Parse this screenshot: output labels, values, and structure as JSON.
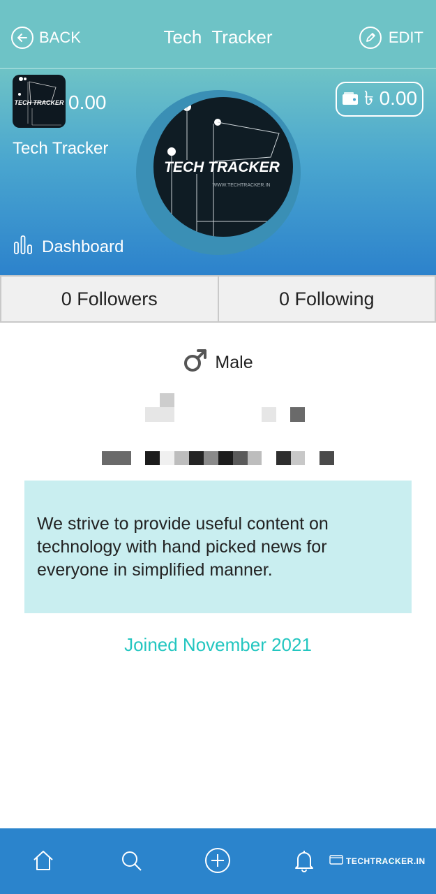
{
  "header": {
    "back_label": "BACK",
    "title": "Tech  Tracker",
    "edit_label": "EDIT",
    "back_icon": "arrow-left-circle-icon",
    "edit_icon": "pencil-circle-icon"
  },
  "profile": {
    "thumb_text": "TECH TRACKER",
    "points": "0.00",
    "name": "Tech Tracker",
    "dashboard_label": "Dashboard",
    "wallet_amount": "৳ 0.00",
    "avatar_text": "TECH TRACKER",
    "avatar_subtext": "WWW.TECHTRACKER.IN"
  },
  "stats": {
    "followers": "0 Followers",
    "following": "0 Following"
  },
  "about": {
    "gender": "Male",
    "bio": "We strive to provide useful content on technology with hand picked news for everyone in simplified manner.",
    "joined": "Joined November 2021"
  },
  "bottom_nav": {
    "items": [
      "home-icon",
      "search-icon",
      "add-icon",
      "bell-icon"
    ]
  },
  "watermark": {
    "text": "TECHTRACKER.IN"
  },
  "colors": {
    "topbar": "#6ec3c6",
    "nav": "#2b84cc",
    "accent": "#23c6c0",
    "bio_bg": "#c9eef0"
  }
}
